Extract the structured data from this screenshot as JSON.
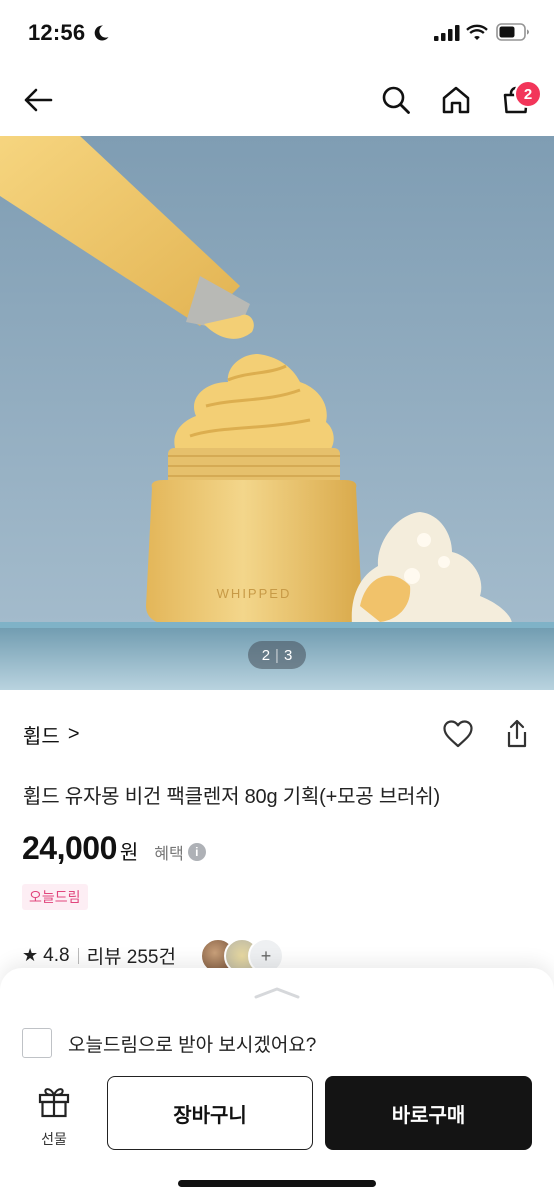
{
  "status_bar": {
    "time": "12:56",
    "icons": [
      "moon-icon",
      "signal-icon",
      "wifi-icon",
      "battery-icon"
    ]
  },
  "nav": {
    "icons": [
      "back-arrow-icon",
      "search-icon",
      "home-icon",
      "shopping-bag-icon"
    ],
    "cart_count": "2"
  },
  "hero": {
    "product_print": "WHIPPED",
    "page_current": "2",
    "page_separator": "|",
    "page_total": "3",
    "colors": {
      "background": "#8ea9bd",
      "cream": "#f3cf75",
      "jar": "#ecc66b"
    }
  },
  "product": {
    "brand": "휩드",
    "brand_chevron": ">",
    "title": "휩드 유자몽 비건 팩클렌저 80g 기획(+모공 브러쉬)",
    "price": "24,000",
    "currency": "원",
    "benefit_label": "혜택",
    "benefit_info": "i",
    "badge": "오늘드림",
    "rating_star": "★",
    "rating": "4.8",
    "review_label": "리뷰 255건",
    "avatar_more": "+"
  },
  "sheet": {
    "checkbox_label": "오늘드림으로 받아 보시겠어요?",
    "gift_label": "선물",
    "cart_button": "장바구니",
    "buy_button": "바로구매"
  },
  "colors": {
    "accent_pink": "#e1467d",
    "badge_red": "#f2365a",
    "buy_dark": "#141414"
  }
}
